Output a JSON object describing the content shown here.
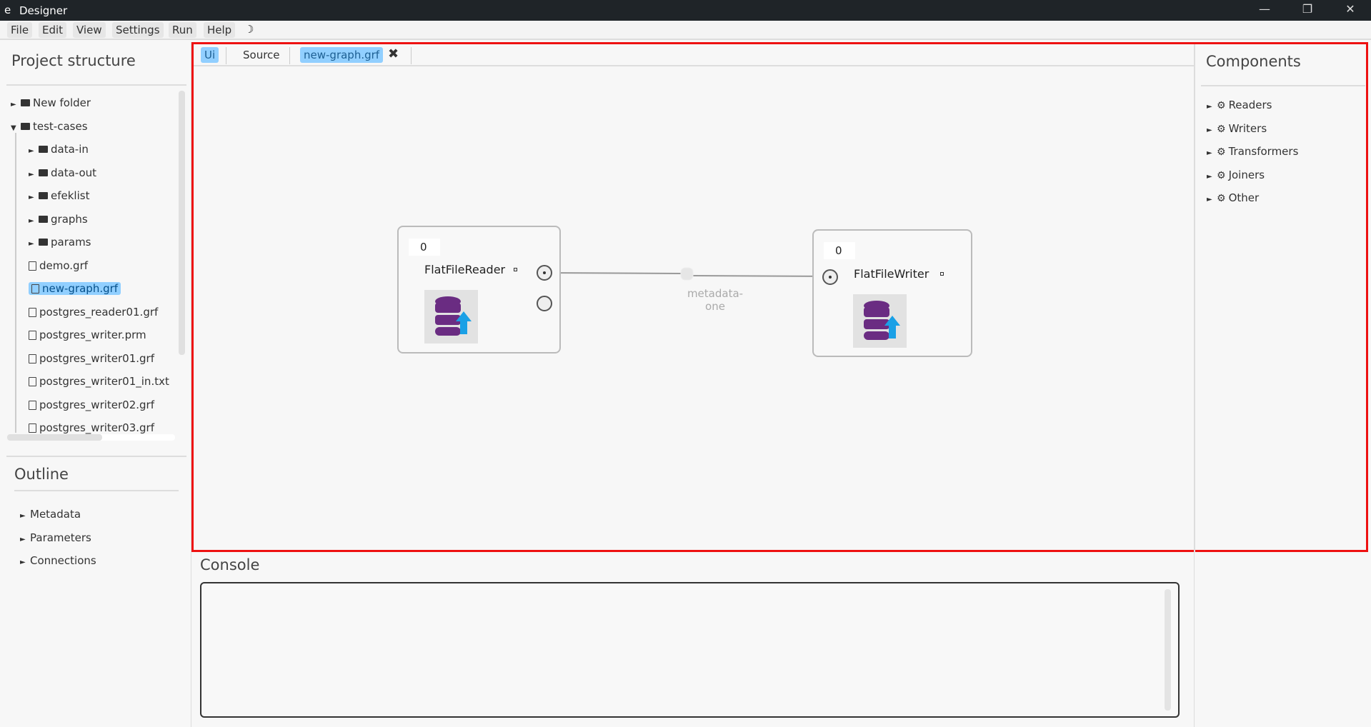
{
  "app": {
    "title": "Designer",
    "logo": "e"
  },
  "window_controls": {
    "minimize": "—",
    "restore": "❐",
    "close": "✕"
  },
  "menu": [
    "File",
    "Edit",
    "View",
    "Settings",
    "Run",
    "Help"
  ],
  "theme_toggle_icon": "moon-icon",
  "project": {
    "title": "Project structure",
    "items": [
      {
        "label": "New folder",
        "type": "folder",
        "level": 0,
        "state": "collapsed"
      },
      {
        "label": "test-cases",
        "type": "folder",
        "level": 0,
        "state": "expanded"
      },
      {
        "label": "data-in",
        "type": "folder",
        "level": 1,
        "state": "collapsed"
      },
      {
        "label": "data-out",
        "type": "folder",
        "level": 1,
        "state": "collapsed"
      },
      {
        "label": "efeklist",
        "type": "folder",
        "level": 1,
        "state": "collapsed"
      },
      {
        "label": "graphs",
        "type": "folder",
        "level": 1,
        "state": "collapsed"
      },
      {
        "label": "params",
        "type": "folder",
        "level": 1,
        "state": "collapsed"
      },
      {
        "label": "demo.grf",
        "type": "file",
        "level": 1
      },
      {
        "label": "new-graph.grf",
        "type": "file",
        "level": 1,
        "selected": true
      },
      {
        "label": "postgres_reader01.grf",
        "type": "file",
        "level": 1
      },
      {
        "label": "postgres_writer.prm",
        "type": "file",
        "level": 1
      },
      {
        "label": "postgres_writer01.grf",
        "type": "file",
        "level": 1
      },
      {
        "label": "postgres_writer01_in.txt",
        "type": "file",
        "level": 1
      },
      {
        "label": "postgres_writer02.grf",
        "type": "file",
        "level": 1
      },
      {
        "label": "postgres_writer03.grf",
        "type": "file",
        "level": 1
      }
    ]
  },
  "outline": {
    "title": "Outline",
    "items": [
      "Metadata",
      "Parameters",
      "Connections"
    ]
  },
  "tabs": [
    {
      "label": "Ui",
      "active": true
    },
    {
      "label": "Source",
      "active": false
    },
    {
      "label": "new-graph.grf",
      "active": true,
      "closable": true
    }
  ],
  "close_tab_icon": "✖",
  "graph": {
    "nodes": [
      {
        "name": "FlatFileReader",
        "counter": "0"
      },
      {
        "name": "FlatFileWriter",
        "counter": "0"
      }
    ],
    "edge": {
      "label": "metadata-one"
    }
  },
  "components": {
    "title": "Components",
    "items": [
      "Readers",
      "Writers",
      "Transformers",
      "Joiners",
      "Other"
    ]
  },
  "console": {
    "title": "Console"
  },
  "colors": {
    "accent": "#91cfff",
    "highlight_border": "#ee1111",
    "db_icon": "#6a2c82",
    "arrow": "#1aa0e6"
  }
}
